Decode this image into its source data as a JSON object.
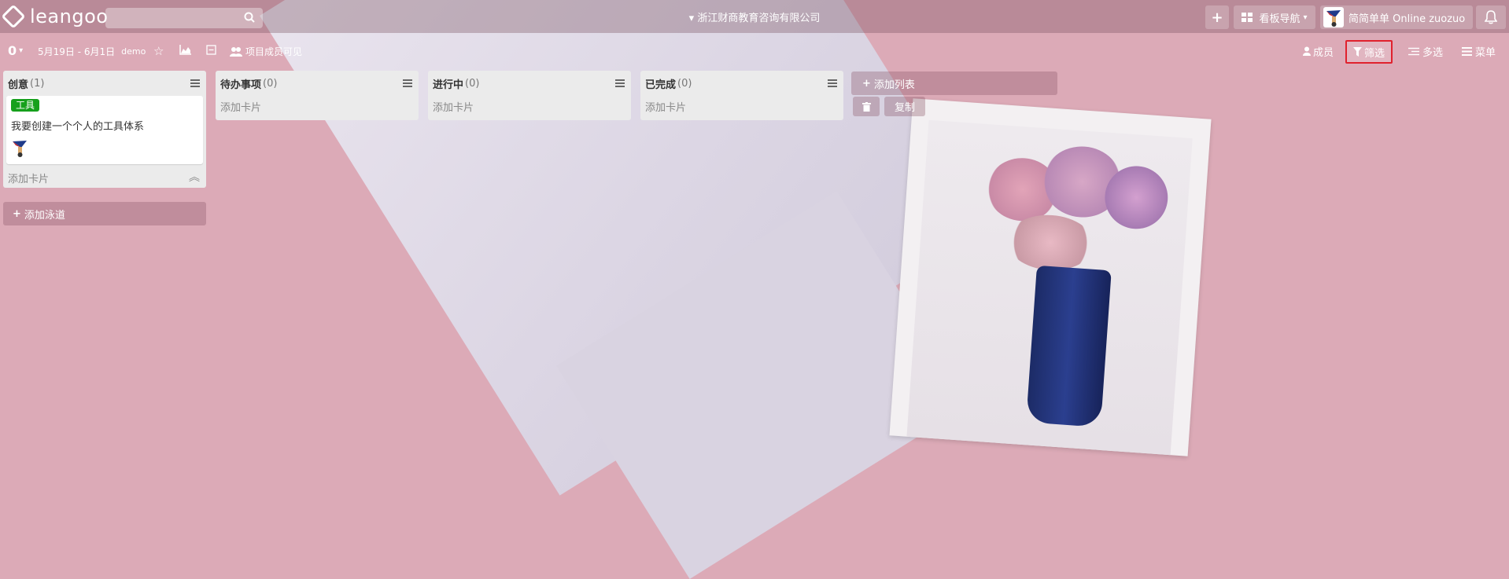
{
  "brand": {
    "logo_text": "leangoo"
  },
  "search": {
    "placeholder": ""
  },
  "header": {
    "company": "浙江财商教育咨询有限公司",
    "plus_label": "+",
    "board_nav_label": "看板导航",
    "user_name": "简简单单 Online zuozuo"
  },
  "subbar": {
    "count": "0",
    "date_range": "5月19日 - 6月1日",
    "board_name": "demo",
    "visibility": "项目成员可见",
    "members": "成员",
    "filter": "筛选",
    "multi_select": "多选",
    "menu": "菜单"
  },
  "lists": [
    {
      "title": "创意",
      "count": "(1)",
      "cards": [
        {
          "label": "工具",
          "label_color": "#16a01c",
          "title": "我要创建一个个人的工具体系"
        }
      ],
      "add_card": "添加卡片"
    },
    {
      "title": "待办事项",
      "count": "(0)",
      "add_card": "添加卡片"
    },
    {
      "title": "进行中",
      "count": "(0)",
      "add_card": "添加卡片"
    },
    {
      "title": "已完成",
      "count": "(0)",
      "add_card": "添加卡片"
    }
  ],
  "actions": {
    "add_lane": "添加泳道",
    "add_list": "添加列表",
    "copy": "复制"
  },
  "colors": {
    "accent_filter_border": "#e0212d",
    "label_green": "#16a01c",
    "background": "#dcaab7"
  }
}
